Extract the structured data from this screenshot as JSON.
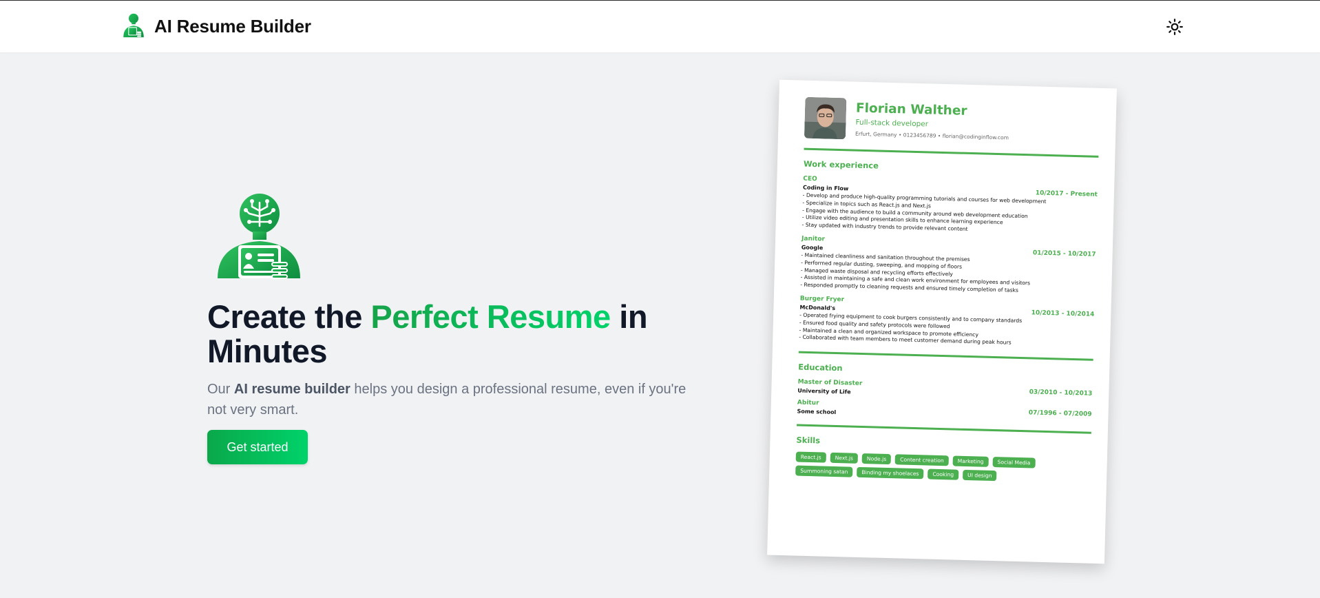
{
  "app": {
    "name": "AI Resume Builder",
    "logo_icon": "robot-resume-icon",
    "theme_toggle_icon": "sun-icon"
  },
  "hero": {
    "headline_start": "Create the",
    "headline_accent": "Perfect Resume",
    "headline_end": "in Minutes",
    "subtext_start": "Our",
    "subtext_bold": "AI resume builder",
    "subtext_end": "helps you design a professional resume, even if you're not very smart.",
    "cta_label": "Get started",
    "accent_colors": [
      "#16a34a",
      "#00d26a"
    ]
  },
  "resume": {
    "name": "Florian Walther",
    "job_title": "Full-stack developer",
    "contact": "Erfurt, Germany • 0123456789 • florian@codinginflow.com",
    "theme_color": "#4caf50",
    "work_heading": "Work experience",
    "work": [
      {
        "position": "CEO",
        "company": "Coding in Flow",
        "dates": "10/2017 - Present",
        "bullets": [
          "- Develop and produce high-quality programming tutorials and courses for web development",
          "- Specialize in topics such as React.js and Next.js",
          "- Engage with the audience to build a community around web development education",
          "- Utilize video editing and presentation skills to enhance learning experience",
          "- Stay updated with industry trends to provide relevant content"
        ]
      },
      {
        "position": "Janitor",
        "company": "Google",
        "dates": "01/2015 - 10/2017",
        "bullets": [
          "- Maintained cleanliness and sanitation throughout the premises",
          "- Performed regular dusting, sweeping, and mopping of floors",
          "- Managed waste disposal and recycling efforts effectively",
          "- Assisted in maintaining a safe and clean work environment for employees and visitors",
          "- Responded promptly to cleaning requests and ensured timely completion of tasks"
        ]
      },
      {
        "position": "Burger Fryer",
        "company": "McDonald's",
        "dates": "10/2013 - 10/2014",
        "bullets": [
          "- Operated frying equipment to cook burgers consistently and to company standards",
          "- Ensured food quality and safety protocols were followed",
          "- Maintained a clean and organized workspace to promote efficiency",
          "- Collaborated with team members to meet customer demand during peak hours"
        ]
      }
    ],
    "education_heading": "Education",
    "education": [
      {
        "degree": "Master of Disaster",
        "school": "University of Life",
        "dates": "03/2010 - 10/2013"
      },
      {
        "degree": "Abitur",
        "school": "Some school",
        "dates": "07/1996 - 07/2009"
      }
    ],
    "skills_heading": "Skills",
    "skills": [
      "React.js",
      "Next.js",
      "Node.js",
      "Content creation",
      "Marketing",
      "Social Media",
      "Summoning satan",
      "Binding my shoelaces",
      "Cooking",
      "UI design"
    ]
  }
}
